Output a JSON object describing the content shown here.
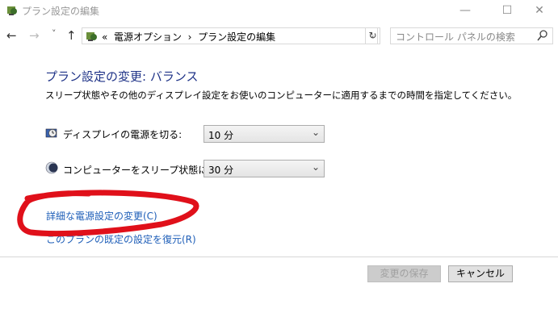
{
  "window": {
    "title": "プラン設定の編集",
    "minimize_icon": "—",
    "maximize_icon": "☐",
    "close_icon": "✕"
  },
  "nav": {
    "back_icon": "←",
    "forward_icon": "→",
    "recent_icon": "˅",
    "up_icon": "↑"
  },
  "address": {
    "prefix": "«",
    "crumb1": "電源オプション",
    "separator": "›",
    "crumb2": "プラン設定の編集",
    "dropdown_icon": "⌄",
    "refresh_icon": "↻"
  },
  "search": {
    "placeholder": "コントロール パネルの検索",
    "icon": "⚲"
  },
  "main": {
    "heading": "プラン設定の変更: バランス",
    "description": "スリープ状態やその他のディスプレイ設定をお使いのコンピューターに適用するまでの時間を指定してください。",
    "display_off_label": "ディスプレイの電源を切る:",
    "display_off_value": "10 分",
    "sleep_label": "コンピューターをスリープ状態にする:",
    "sleep_value": "30 分",
    "select_arrow": "⌄",
    "advanced_link": "詳細な電源設定の変更(C)",
    "restore_link": "このプランの既定の設定を復元(R)"
  },
  "footer": {
    "save_label": "変更の保存",
    "cancel_label": "キャンセル"
  },
  "colors": {
    "heading": "#1e3287",
    "link": "#1e5eb8",
    "annotation": "#e0101a"
  }
}
